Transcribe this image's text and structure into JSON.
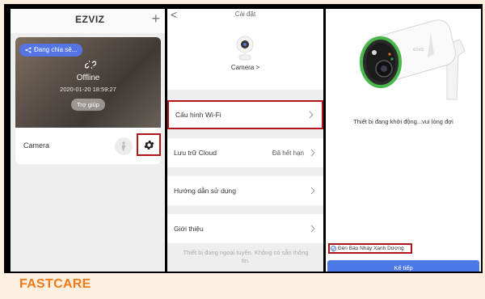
{
  "panel1": {
    "app_title": "EZVIZ",
    "add_symbol": "+",
    "share_label": "Đang chia sẻ...",
    "status": "Offline",
    "timestamp": "2020-01-20 18:59:27",
    "help_button": "Trợ giúp",
    "camera_name": "Camera",
    "icons": [
      "plus-icon",
      "share-icon",
      "unlink-icon",
      "person-icon",
      "gear-icon"
    ]
  },
  "panel2": {
    "back_symbol": "<",
    "title": "Cài đặt",
    "device_label": "Camera >",
    "items": [
      {
        "label": "Cấu hình Wi-Fi",
        "value": ""
      },
      {
        "label": "Lưu trữ Cloud",
        "value": "Đã hết hạn"
      },
      {
        "label": "Hướng dẫn sử dụng",
        "value": ""
      },
      {
        "label": "Giới thiệu",
        "value": ""
      }
    ],
    "footer_note": "Thiết bị đang ngoại tuyến. Không có sẵn thông tin."
  },
  "panel3": {
    "status_text": "Thiết bị đang khởi động...vui lòng đợi",
    "checkbox_label": "Đèn Báo Nháy Xanh Dương",
    "next_button": "Kế tiếp"
  },
  "brand": "FASTCARE",
  "colors": {
    "highlight": "#b0161c",
    "accent_blue": "#4d79e8",
    "brand_orange": "#f07a1a"
  }
}
